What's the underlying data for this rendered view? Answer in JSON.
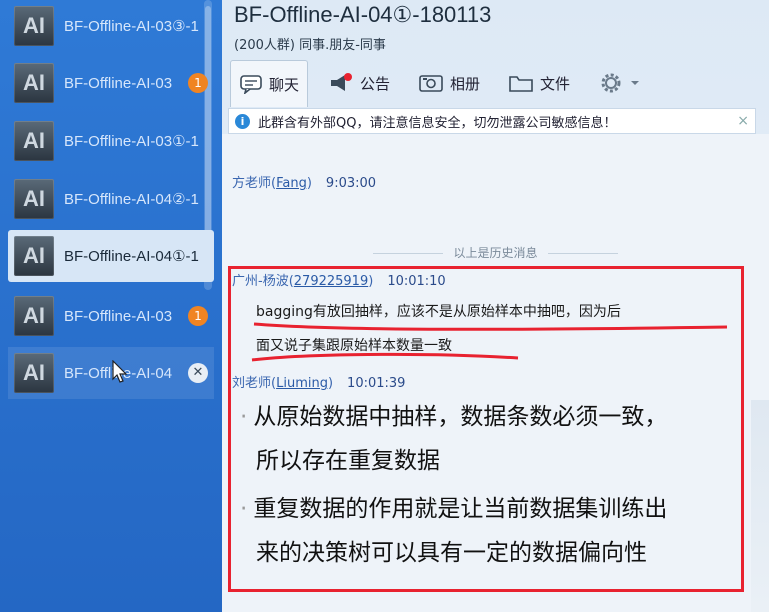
{
  "sidebar": {
    "items": [
      {
        "icon_text": "AI",
        "name": "BF-Offline-AI-03③-1",
        "badge": null
      },
      {
        "icon_text": "AI",
        "name": "BF-Offline-AI-03",
        "badge": "1"
      },
      {
        "icon_text": "AI",
        "name": "BF-Offline-AI-03①-1",
        "badge": null
      },
      {
        "icon_text": "AI",
        "name": "BF-Offline-AI-04②-1",
        "badge": null
      },
      {
        "icon_text": "AI",
        "name": "BF-Offline-AI-04①-1",
        "badge": null
      },
      {
        "icon_text": "AI",
        "name": "BF-Offline-AI-03",
        "badge": "1"
      },
      {
        "icon_text": "AI",
        "name": "BF-Offline-AI-04",
        "badge": null
      }
    ],
    "close_glyph": "✕",
    "accent_color": "#2467c4"
  },
  "header": {
    "title": "BF-Offline-AI-04①-180113",
    "subtitle": "(200人群) 同事.朋友-同事"
  },
  "tabs": [
    {
      "label": "聊天",
      "icon": "chat-bubble-icon"
    },
    {
      "label": "公告",
      "icon": "megaphone-icon"
    },
    {
      "label": "相册",
      "icon": "photo-album-icon"
    },
    {
      "label": "文件",
      "icon": "folder-icon"
    },
    {
      "label": "",
      "icon": "gear-icon"
    }
  ],
  "notice": {
    "info": "i",
    "text": "此群含有外部QQ，请注意信息安全，切勿泄露公司敏感信息！",
    "close": "×"
  },
  "chat": {
    "msg1": {
      "nick": "方老师",
      "qq": "Fang",
      "time": "9:03:00"
    },
    "history_label": "以上是历史消息",
    "msg2": {
      "nick": "广州-杨波",
      "qq": "279225919",
      "time": "10:01:10",
      "lines": [
        "bagging有放回抽样，应该不是从原始样本中抽吧，因为后",
        "面又说子集跟原始样本数量一致"
      ]
    },
    "msg3": {
      "nick": "刘老师",
      "qq": "Liuming",
      "time": "10:01:39",
      "lines": [
        "从原始数据中抽样，数据条数必须一致，",
        "所以存在重复数据",
        "重复数据的作用就是让当前数据集训练出",
        "来的决策树可以具有一定的数据偏向性"
      ]
    }
  },
  "colors": {
    "annotation_red": "#e82230",
    "badge_orange": "#f08422"
  }
}
